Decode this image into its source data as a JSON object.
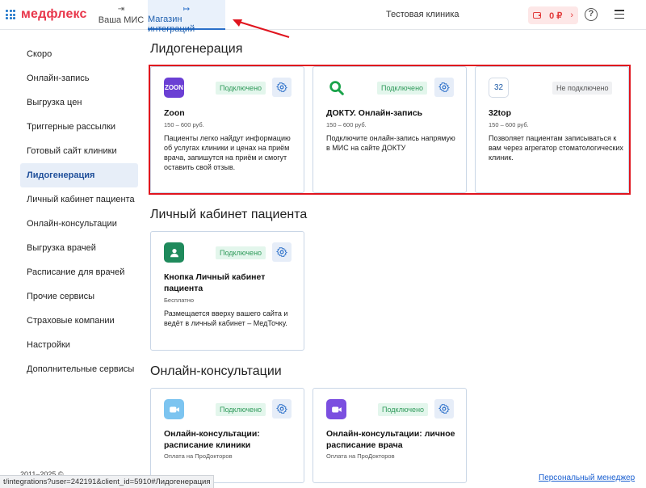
{
  "header": {
    "logo": "медфлекс",
    "tabs": [
      {
        "label": "Ваша МИС"
      },
      {
        "label": "Магазин интеграций"
      }
    ],
    "clinic": "Тестовая клиника",
    "balance": "0 ₽"
  },
  "sidebar": {
    "items": [
      {
        "label": "Скоро"
      },
      {
        "label": "Онлайн-запись"
      },
      {
        "label": "Выгрузка цен"
      },
      {
        "label": "Триггерные рассылки"
      },
      {
        "label": "Готовый сайт клиники"
      },
      {
        "label": "Лидогенерация"
      },
      {
        "label": "Личный кабинет пациента"
      },
      {
        "label": "Онлайн-консультации"
      },
      {
        "label": "Выгрузка врачей"
      },
      {
        "label": "Расписание для врачей"
      },
      {
        "label": "Прочие сервисы"
      },
      {
        "label": "Страховые компании"
      },
      {
        "label": "Настройки"
      },
      {
        "label": "Дополнительные сервисы"
      }
    ]
  },
  "sections": [
    {
      "title": "Лидогенерация",
      "cards": [
        {
          "logo_text": "ZOON",
          "logo_color": "#6b3fd4",
          "status": "Подключено",
          "title": "Zoon",
          "price": "150 – 600 руб.",
          "desc": "Пациенты легко найдут информацию об услугах клиники и ценах на приём врача, запишутся на приём и смогут оставить свой отзыв."
        },
        {
          "logo_text": "",
          "logo_color": "#1aa34a",
          "status": "Подключено",
          "title": "ДОКТУ. Онлайн-запись",
          "price": "150 – 600 руб.",
          "desc": "Подключите онлайн-запись напрямую в МИС на сайте ДОКТУ"
        },
        {
          "logo_text": "32",
          "logo_color": "#1d5aa6",
          "status": "Не подключено",
          "title": "32top",
          "price": "150 – 600 руб.",
          "desc": "Позволяет пациентам записываться к вам через агрегатор стоматологических клиник."
        }
      ]
    },
    {
      "title": "Личный кабинет пациента",
      "cards": [
        {
          "status": "Подключено",
          "title": "Кнопка Личный кабинет пациента",
          "price": "Бесплатно",
          "desc": "Размещается вверху вашего сайта и ведёт в личный кабинет – МедТочку."
        }
      ]
    },
    {
      "title": "Онлайн-консультации",
      "cards": [
        {
          "status": "Подключено",
          "title": "Онлайн-консультации: расписание клиники",
          "price": "Оплата на ПроДокторов"
        },
        {
          "status": "Подключено",
          "title": "Онлайн-консультации: личное расписание врача",
          "price": "Оплата на ПроДокторов"
        }
      ]
    }
  ],
  "footer": {
    "copyright": "2011–2025 ©",
    "status_url": "t/integrations?user=242191&client_id=5910#Лидогенерация",
    "manager_link": "Персональный менеджер"
  },
  "colors": {
    "accent": "#2a6fc9",
    "connected": "#2f9a5a",
    "highlight": "#e0141e"
  }
}
